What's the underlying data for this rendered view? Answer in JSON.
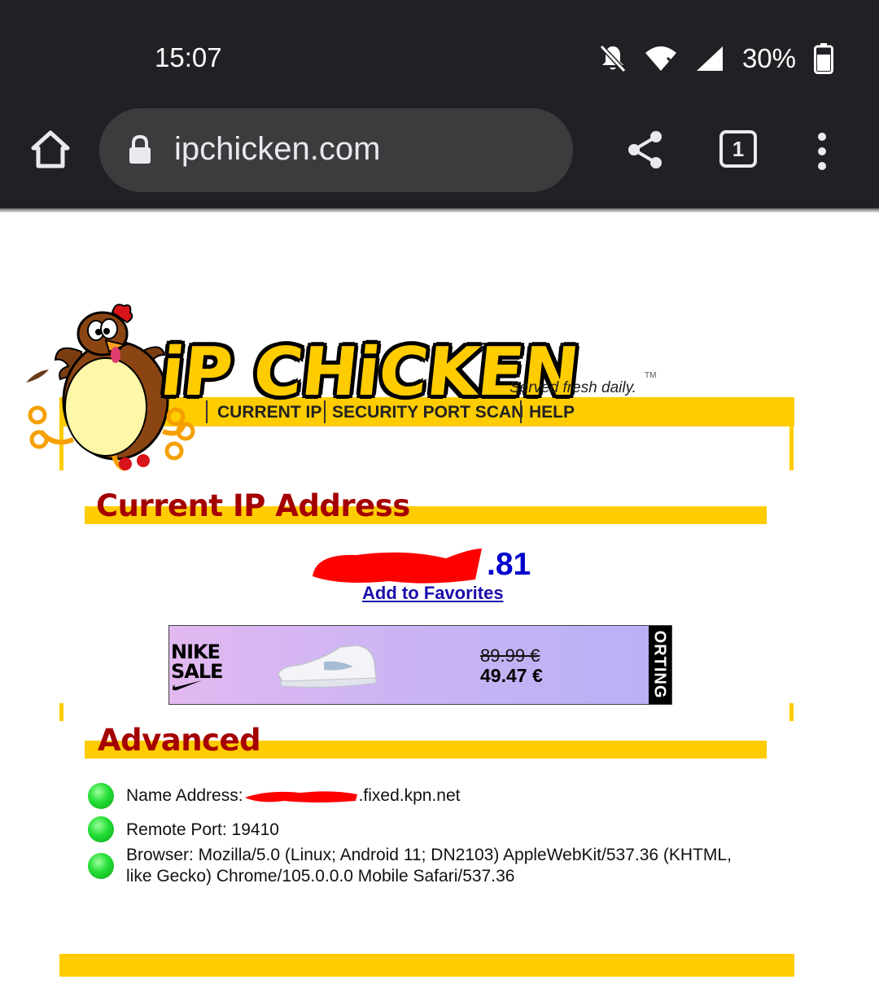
{
  "status_bar": {
    "time": "15:07",
    "battery": "30%",
    "icons": [
      "notifications-off-icon",
      "wifi-icon",
      "signal-icon",
      "battery-icon"
    ]
  },
  "browser": {
    "url": "ipchicken.com",
    "tab_count": "1",
    "icons": [
      "home-icon",
      "lock-icon",
      "share-icon",
      "tab-switcher-icon",
      "more-vert-icon"
    ]
  },
  "site": {
    "logo_text": "iP CHiCKEN",
    "tagline": "Served fresh daily.",
    "trademark": "TM",
    "nav": [
      "CURRENT IP",
      "SECURITY PORT SCAN",
      "HELP"
    ]
  },
  "current_ip": {
    "heading": "Current IP Address",
    "ip_visible_suffix": ".81",
    "favorites_link": "Add to Favorites"
  },
  "ad": {
    "brand_line1": "NIKE",
    "brand_line2": "SALE",
    "old_price": "89.99 €",
    "new_price": "49.47 €",
    "side_text": "ORTING"
  },
  "advanced": {
    "heading": "Advanced",
    "name_label": "Name Address:",
    "name_suffix": ".fixed.kpn.net",
    "remote_port": "Remote Port: 19410",
    "browser_line1": "Browser: Mozilla/5.0 (Linux; Android 11; DN2103) AppleWebKit/537.36 (KHTML,",
    "browser_line2": "like Gecko) Chrome/105.0.0.0 Mobile Safari/537.36"
  },
  "colors": {
    "accent_yellow": "#ffcc00",
    "heading_red": "#a50000",
    "ip_blue": "#0000cc",
    "redaction_red": "#ff0000",
    "status_green": "#22dd33"
  }
}
